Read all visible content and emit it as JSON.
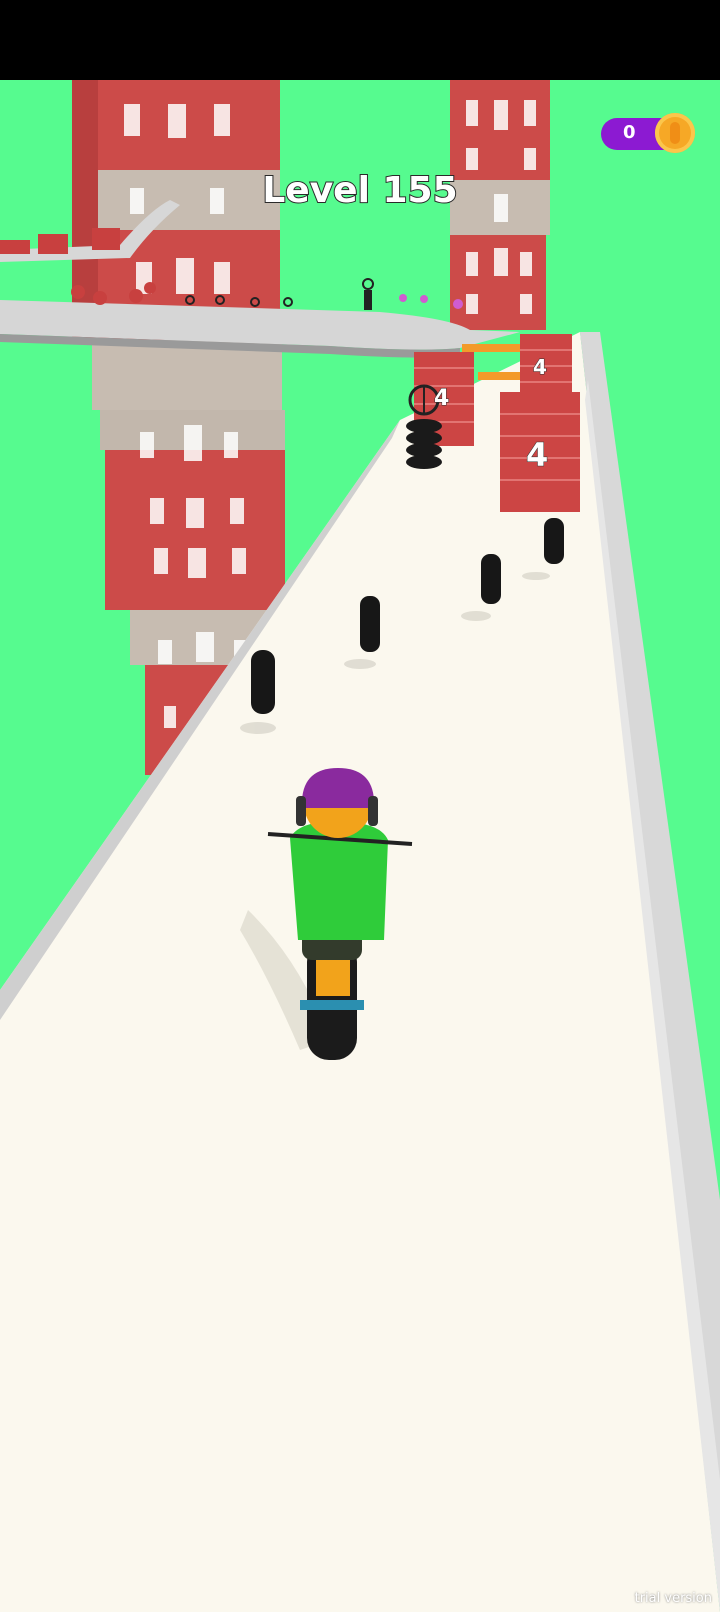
{
  "hud": {
    "level_label": "Level 155",
    "coin_count": "0"
  },
  "obstacles": {
    "wall_count_labels": [
      "4",
      "4",
      "4"
    ]
  },
  "watermark": "trial version",
  "colors": {
    "sky_ground": "#56fb8f",
    "road": "#fbf8ee",
    "building_brick": "#cc4b49",
    "building_band": "#c2b7ac",
    "coin_pill": "#8c1ad2",
    "coin": "#f6a826",
    "rider_shirt": "#2fcc3a",
    "rider_helmet": "#8a2a9e"
  }
}
